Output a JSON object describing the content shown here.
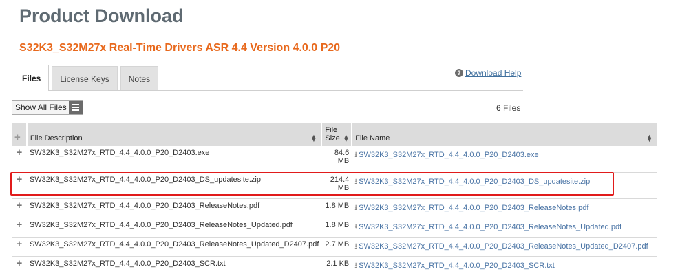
{
  "page_title": "Product Download",
  "product_title": "S32K3_S32M27x Real-Time Drivers ASR 4.4 Version 4.0.0 P20",
  "tabs": [
    {
      "label": "Files"
    },
    {
      "label": "License Keys"
    },
    {
      "label": "Notes"
    }
  ],
  "help": {
    "icon": "?",
    "label": "Download Help"
  },
  "toolbar": {
    "show_all_label": "Show All Files",
    "file_count": "6 Files"
  },
  "table": {
    "headers": {
      "description": "File Description",
      "size_line1": "File",
      "size_line2": "Size",
      "name": "File Name"
    },
    "rows": [
      {
        "description": "SW32K3_S32M27x_RTD_4.4_4.0.0_P20_D2403.exe",
        "size_line1": "84.6",
        "size_line2": "MB",
        "name": "SW32K3_S32M27x_RTD_4.4_4.0.0_P20_D2403.exe"
      },
      {
        "description": "SW32K3_S32M27x_RTD_4.4_4.0.0_P20_D2403_DS_updatesite.zip",
        "size_line1": "214.4",
        "size_line2": "MB",
        "name": "SW32K3_S32M27x_RTD_4.4_4.0.0_P20_D2403_DS_updatesite.zip"
      },
      {
        "description": "SW32K3_S32M27x_RTD_4.4_4.0.0_P20_D2403_ReleaseNotes.pdf",
        "size_line1": "1.8 MB",
        "size_line2": "",
        "name": "SW32K3_S32M27x_RTD_4.4_4.0.0_P20_D2403_ReleaseNotes.pdf"
      },
      {
        "description": "SW32K3_S32M27x_RTD_4.4_4.0.0_P20_D2403_ReleaseNotes_Updated.pdf",
        "size_line1": "1.8 MB",
        "size_line2": "",
        "name": "SW32K3_S32M27x_RTD_4.4_4.0.0_P20_D2403_ReleaseNotes_Updated.pdf"
      },
      {
        "description": "SW32K3_S32M27x_RTD_4.4_4.0.0_P20_D2403_ReleaseNotes_Updated_D2407.pdf",
        "size_line1": "2.7 MB",
        "size_line2": "",
        "name": "SW32K3_S32M27x_RTD_4.4_4.0.0_P20_D2403_ReleaseNotes_Updated_D2407.pdf"
      },
      {
        "description": "SW32K3_S32M27x_RTD_4.4_4.0.0_P20_D2403_SCR.txt",
        "size_line1": "2.1 KB",
        "size_line2": "",
        "name": "SW32K3_S32M27x_RTD_4.4_4.0.0_P20_D2403_SCR.txt"
      }
    ]
  },
  "colors": {
    "title": "#5f6a72",
    "product_title": "#e8691d",
    "link": "#4a74a5",
    "highlight": "#e11b1b"
  },
  "icons": {
    "expand": "plus-icon",
    "sort": "sort-icon",
    "download": "download-icon",
    "help": "help-icon",
    "menu": "list-icon"
  }
}
